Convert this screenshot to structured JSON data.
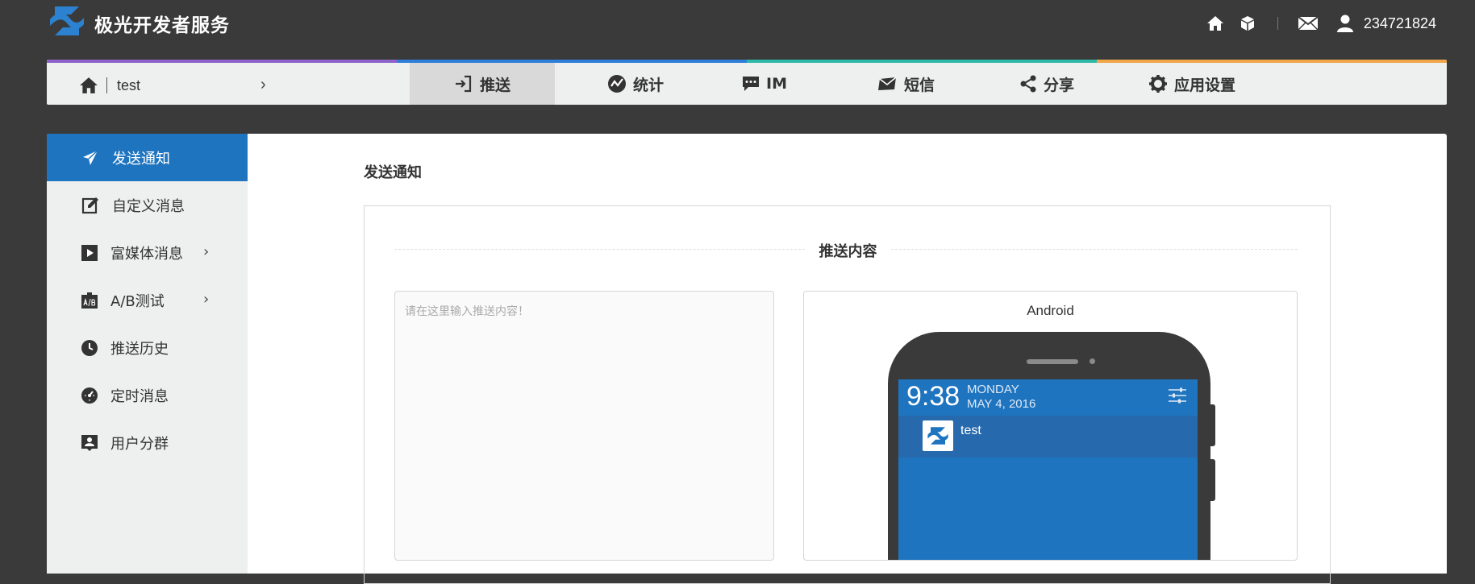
{
  "header": {
    "brand": "极光开发者服务",
    "user_id": "234721824"
  },
  "nav": {
    "app_name": "test",
    "items": [
      {
        "label": "推送",
        "icon": "push-icon",
        "active": true
      },
      {
        "label": "统计",
        "icon": "stats-icon",
        "active": false
      },
      {
        "label": "IM",
        "icon": "chat-icon",
        "active": false
      },
      {
        "label": "短信",
        "icon": "sms-icon",
        "active": false
      },
      {
        "label": "分享",
        "icon": "share-icon",
        "active": false
      },
      {
        "label": "应用设置",
        "icon": "gear-icon",
        "active": false
      }
    ],
    "stripe_colors": [
      "#8e63c9",
      "#2f7ed8",
      "#2fb8a8",
      "#f0a64a"
    ]
  },
  "sidebar": {
    "items": [
      {
        "label": "发送通知",
        "icon": "paper-plane-icon",
        "active": true
      },
      {
        "label": "自定义消息",
        "icon": "edit-icon",
        "active": false
      },
      {
        "label": "富媒体消息",
        "icon": "play-icon",
        "active": false
      },
      {
        "label": "A/B测试",
        "icon": "ab-test-icon",
        "active": false
      },
      {
        "label": "推送历史",
        "icon": "clock-icon",
        "active": false
      },
      {
        "label": "定时消息",
        "icon": "timer-icon",
        "active": false
      },
      {
        "label": "用户分群",
        "icon": "user-group-icon",
        "active": false
      }
    ]
  },
  "main": {
    "page_title": "发送通知",
    "section_title": "推送内容",
    "input": {
      "placeholder": "请在这里输入推送内容！",
      "value": ""
    },
    "preview": {
      "platform": "Android",
      "time": "9:38",
      "day": "MONDAY",
      "date": "MAY 4, 2016",
      "notification_title": "test"
    }
  },
  "colors": {
    "accent": "#1e74bf",
    "background": "#3a3a3a",
    "panel": "#eef0f0"
  }
}
